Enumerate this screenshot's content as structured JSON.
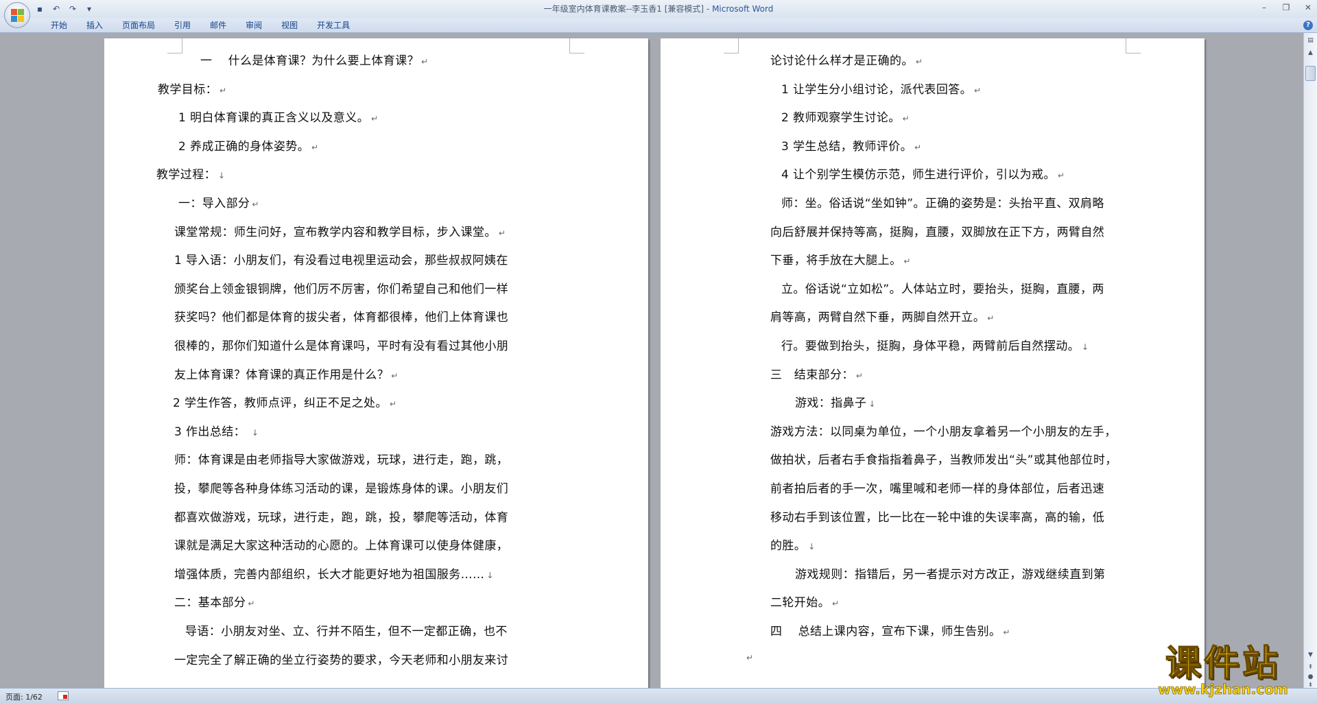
{
  "window": {
    "title": "一年级室内体育课教案--李玉香1 [兼容模式]",
    "title_sep": " - ",
    "app_name": "Microsoft Word"
  },
  "quick_access": [
    "save-icon",
    "undo-icon",
    "redo-icon",
    "customize-icon"
  ],
  "ribbon": {
    "tabs": [
      "开始",
      "插入",
      "页面布局",
      "引用",
      "邮件",
      "审阅",
      "视图",
      "开发工具"
    ]
  },
  "document": {
    "left_page": [
      {
        "text": "一　 什么是体育课？为什么要上体育课？",
        "mark": "↵"
      },
      {
        "text": "教学目标：",
        "mark": "↵"
      },
      {
        "text": "1 明白体育课的真正含义以及意义。",
        "mark": "↵"
      },
      {
        "text": "2 养成正确的身体姿势。",
        "mark": "↵"
      },
      {
        "text": "教学过程：",
        "mark": "↓"
      },
      {
        "text": "一：导入部分",
        "mark": "↵"
      },
      {
        "text": "课堂常规：师生问好，宣布教学内容和教学目标，步入课堂。",
        "mark": "↵"
      },
      {
        "text": "1  导入语：小朋友们，有没看过电视里运动会，那些叔叔阿姨在",
        "mark": ""
      },
      {
        "text": "颁奖台上领金银铜牌，他们厉不厉害，你们希望自己和他们一样",
        "mark": ""
      },
      {
        "text": "获奖吗？他们都是体育的拔尖者，体育都很棒，他们上体育课也",
        "mark": ""
      },
      {
        "text": "很棒的，那你们知道什么是体育课吗，平时有没有看过其他小朋",
        "mark": ""
      },
      {
        "text": "友上体育课？体育课的真正作用是什么？",
        "mark": "↵"
      },
      {
        "text": "2  学生作答，教师点评，纠正不足之处。",
        "mark": "↵"
      },
      {
        "text": "3  作出总结：  ",
        "mark": "↓"
      },
      {
        "text": "师：体育课是由老师指导大家做游戏，玩球，进行走，跑，跳，",
        "mark": ""
      },
      {
        "text": "投，攀爬等各种身体练习活动的课，是锻炼身体的课。小朋友们",
        "mark": ""
      },
      {
        "text": "都喜欢做游戏，玩球，进行走，跑，跳，投，攀爬等活动，体育",
        "mark": ""
      },
      {
        "text": "课就是满足大家这种活动的心愿的。上体育课可以使身体健康，",
        "mark": ""
      },
      {
        "text": "增强体质，完善内部组织，长大才能更好地为祖国服务……",
        "mark": "↓"
      },
      {
        "text": "二：基本部分",
        "mark": "↵"
      },
      {
        "text": "导语：小朋友对坐、立、行并不陌生，但不一定都正确，也不",
        "mark": ""
      },
      {
        "text": "一定完全了解正确的坐立行姿势的要求，今天老师和小朋友来讨",
        "mark": ""
      }
    ],
    "right_page": [
      {
        "text": "论讨论什么样才是正确的。",
        "mark": "↵"
      },
      {
        "text": "1 让学生分小组讨论，派代表回答。",
        "mark": "↵"
      },
      {
        "text": "2 教师观察学生讨论。",
        "mark": "↵"
      },
      {
        "text": "3 学生总结，教师评价。",
        "mark": "↵"
      },
      {
        "text": "4 让个别学生模仿示范，师生进行评价，引以为戒。",
        "mark": "↵"
      },
      {
        "text": "师：坐。俗话说“坐如钟”。正确的姿势是：头抬平直、双肩略",
        "mark": ""
      },
      {
        "text": "向后舒展并保持等高，挺胸，直腰，双脚放在正下方，两臂自然",
        "mark": ""
      },
      {
        "text": "下垂，将手放在大腿上。",
        "mark": "↵"
      },
      {
        "text": "立。俗话说“立如松”。人体站立时，要抬头，挺胸，直腰，两",
        "mark": ""
      },
      {
        "text": "肩等高，两臂自然下垂，两脚自然开立。",
        "mark": "↵"
      },
      {
        "text": "行。要做到抬头，挺胸，身体平稳，两臂前后自然摆动。",
        "mark": "↓"
      },
      {
        "text": "三　结束部分：",
        "mark": "↵"
      },
      {
        "text": "游戏：指鼻子",
        "mark": "↓"
      },
      {
        "text": "游戏方法：以同桌为单位，一个小朋友拿着另一个小朋友的左手，",
        "mark": ""
      },
      {
        "text": "做拍状，后者右手食指指着鼻子，当教师发出“头”或其他部位时，",
        "mark": ""
      },
      {
        "text": "前者拍后者的手一次，嘴里喊和老师一样的身体部位，后者迅速",
        "mark": ""
      },
      {
        "text": "移动右手到该位置，比一比在一轮中谁的失误率高，高的输，低",
        "mark": ""
      },
      {
        "text": "的胜。",
        "mark": "↓"
      },
      {
        "text": "游戏规则：指错后，另一者提示对方改正，游戏继续直到第",
        "mark": ""
      },
      {
        "text": "二轮开始。",
        "mark": "↵"
      },
      {
        "text": "四　 总结上课内容，宣布下课，师生告别。",
        "mark": "↵"
      },
      {
        "text": "",
        "mark": "↵"
      }
    ]
  },
  "statusbar": {
    "page_label": "页面: 1/62"
  },
  "watermark": {
    "title": "课件站",
    "url": "www.kjzhan.com"
  }
}
